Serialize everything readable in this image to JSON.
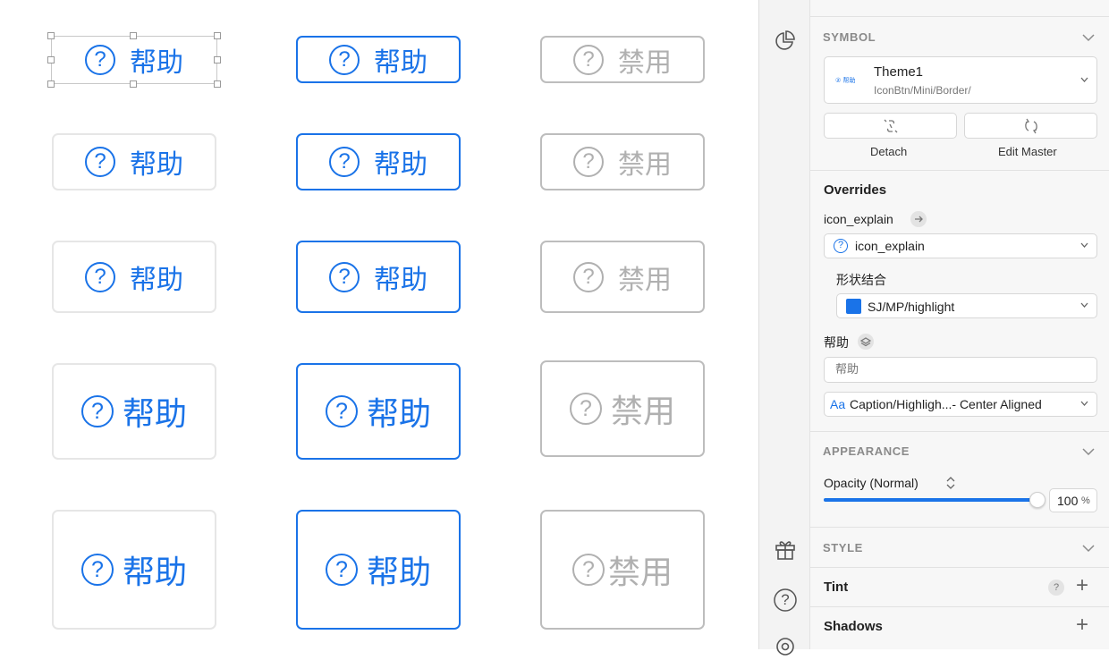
{
  "canvas": {
    "button_label": "帮助",
    "disabled_label": "禁用",
    "question_glyph": "?",
    "colors": {
      "primary": "#1a73e8",
      "light_border": "#e6e6e6",
      "disabled": "#b0b0b0"
    }
  },
  "toolbar": {
    "icons": [
      "pie-chart-icon",
      "gift-icon",
      "help-circle-icon",
      "settings-icon"
    ],
    "help_glyph": "?"
  },
  "inspector": {
    "symbol": {
      "header": "SYMBOL",
      "name": "Theme1",
      "path": "IconBtn/Mini/Border/",
      "thumb_label": "② 帮助",
      "detach_label": "Detach",
      "edit_master_label": "Edit Master"
    },
    "overrides": {
      "title": "Overrides",
      "icon_label": "icon_explain",
      "icon_value": "icon_explain",
      "icon_glyph": "?",
      "shape_label": "形状结合",
      "color_value": "SJ/MP/highlight",
      "color_swatch": "#1a73e8",
      "text_label": "帮助",
      "text_placeholder": "帮助",
      "style_prefix": "Aa",
      "style_value": "Caption/Highligh...- Center Aligned"
    },
    "appearance": {
      "header": "APPEARANCE",
      "opacity_label": "Opacity (Normal)",
      "opacity_value": "100",
      "opacity_unit": "%",
      "opacity_fraction": 1.0
    },
    "style": {
      "header": "STYLE",
      "tint_label": "Tint",
      "tint_help": "?",
      "shadows_label": "Shadows",
      "add": "+"
    }
  }
}
